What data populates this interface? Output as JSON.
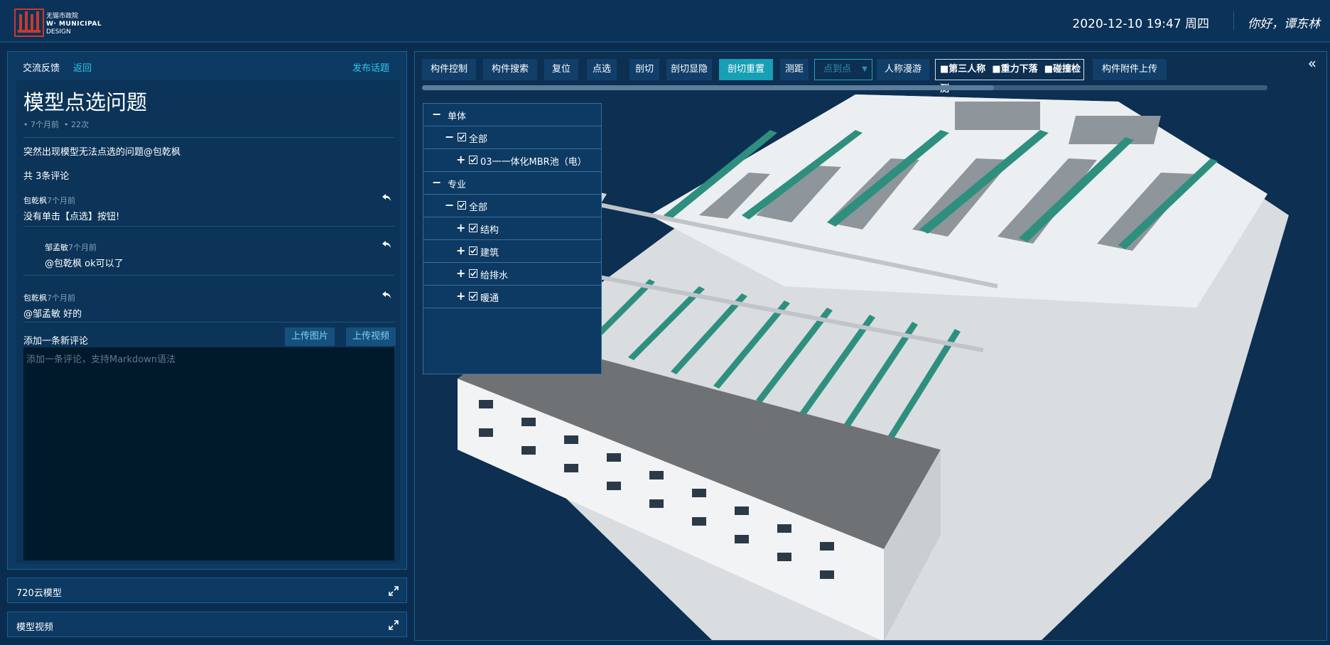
{
  "header": {
    "logo_cn": "无锡市政院",
    "logo_en1": "W· MUNICIPAL",
    "logo_en2": "DESIGN",
    "datetime": "2020-12-10  19:47 周四",
    "greeting": "你好，谭东林"
  },
  "feedback": {
    "section_title": "交流反馈",
    "back_label": "返回",
    "publish_label": "发布话题",
    "post_title": "模型点选问题",
    "post_age": "7个月前",
    "post_views": "22次",
    "post_body": "突然出现模型无法点选的问题@包乾枫",
    "comment_count": "共 3条评论",
    "comments": [
      {
        "author": "包乾枫",
        "time": "7个月前",
        "text": "没有单击【点选】按钮!"
      },
      {
        "author": "邹孟敏",
        "time": "7个月前",
        "text": "@包乾枫 ok可以了"
      },
      {
        "author": "包乾枫",
        "time": "7个月前",
        "text": "@邹孟敏 好的"
      }
    ],
    "add_comment_label": "添加一条新评论",
    "upload_image_label": "上传图片",
    "upload_video_label": "上传视频",
    "comment_placeholder": "添加一条评论，支持Markdown语法"
  },
  "panels": {
    "cloud_model_label": "720云模型",
    "model_video_label": "模型视频"
  },
  "toolbar": {
    "component_control": "构件控制",
    "component_search": "构件搜索",
    "reset": "复位",
    "point_select": "点选",
    "section": "剖切",
    "section_toggle": "剖切显隐",
    "section_reset": "剖切重置",
    "measure": "测距",
    "measure_mode": "点到点",
    "walkthrough": "人称漫游",
    "third_person": "第三人称",
    "gravity": "重力下落",
    "collision": "碰撞检测",
    "attachment_upload": "构件附件上传"
  },
  "tree": {
    "group_single": "单体",
    "all_1": "全部",
    "item_mbr": "03一一体化MBR池（电）",
    "group_discipline": "专业",
    "all_2": "全部",
    "item_structure": "结构",
    "item_architecture": "建筑",
    "item_plumbing": "给排水",
    "item_hvac": "暖通"
  },
  "colors": {
    "accent": "#31c5e8",
    "active_button": "#179fb5",
    "panel_bg": "#0c3a63",
    "page_bg": "#0a2d4f"
  }
}
